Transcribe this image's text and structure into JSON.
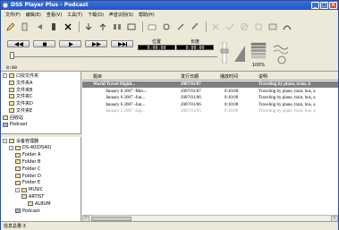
{
  "app": {
    "title": "DSS Player Plus - Podcast"
  },
  "menu": [
    "文件(F)",
    "编辑(E)",
    "查看(V)",
    "工具(T)",
    "下载(D)",
    "声音识别(S)",
    "帮助(H)"
  ],
  "transport": {
    "position_label": "位置",
    "position_value": "0:00:00",
    "length_label": "长度",
    "length_value": "0:00:00",
    "start_time": "0:00",
    "speed_label": "100%"
  },
  "tree_top": [
    {
      "label": "口授文件夹",
      "level": 0,
      "exp": "-"
    },
    {
      "label": "文件夹A",
      "level": 1
    },
    {
      "label": "文件夹B",
      "level": 1
    },
    {
      "label": "文件夹C",
      "level": 1
    },
    {
      "label": "文件夹D",
      "level": 1
    },
    {
      "label": "文件夹E",
      "level": 1
    },
    {
      "label": "回收站",
      "level": 0
    },
    {
      "label": "Podcast",
      "level": 0
    }
  ],
  "tree_bottom": [
    {
      "label": "设备管理器",
      "level": 0,
      "exp": "-"
    },
    {
      "label": "DS-40(DS40)",
      "level": 1,
      "exp": "-"
    },
    {
      "label": "Folder A",
      "level": 2
    },
    {
      "label": "Folder B",
      "level": 2
    },
    {
      "label": "Folder C",
      "level": 2
    },
    {
      "label": "Folder D",
      "level": 2
    },
    {
      "label": "Folder E",
      "level": 2
    },
    {
      "label": "MUSIC",
      "level": 2,
      "exp": "-"
    },
    {
      "label": "ARTIST",
      "level": 3
    },
    {
      "label": "ALBUM",
      "level": 4
    },
    {
      "label": "Podcast",
      "level": 2
    }
  ],
  "columns": [
    "题目",
    "发行日期",
    "播放时间",
    "说明"
  ],
  "rows": [
    {
      "title": "World Travel Highli...",
      "date": "2007/01/07",
      "duration": "",
      "desc": "Traveling by plane, train, b"
    },
    {
      "title": "January 8 2007 -Mex...",
      "date": "2007/01/07",
      "duration": "0:10:00",
      "desc": "Traveling by plane, train, bus, a"
    },
    {
      "title": "January 6 2007 -Jun...",
      "date": "2007/01/06",
      "duration": "0:10:00",
      "desc": "Traveling by plane, train, bus, a"
    },
    {
      "title": "January 6 2007 -Jun...",
      "date": "2007/01/06",
      "duration": "0:10:00",
      "desc": "Traveling by plane, train, bus, a"
    },
    {
      "title": "January 5 2007 -Jap...",
      "date": "2007/01/05",
      "duration": "0:10:00",
      "desc": "Traveling by plane, train, bus, a"
    }
  ],
  "status": "信息总量:3"
}
